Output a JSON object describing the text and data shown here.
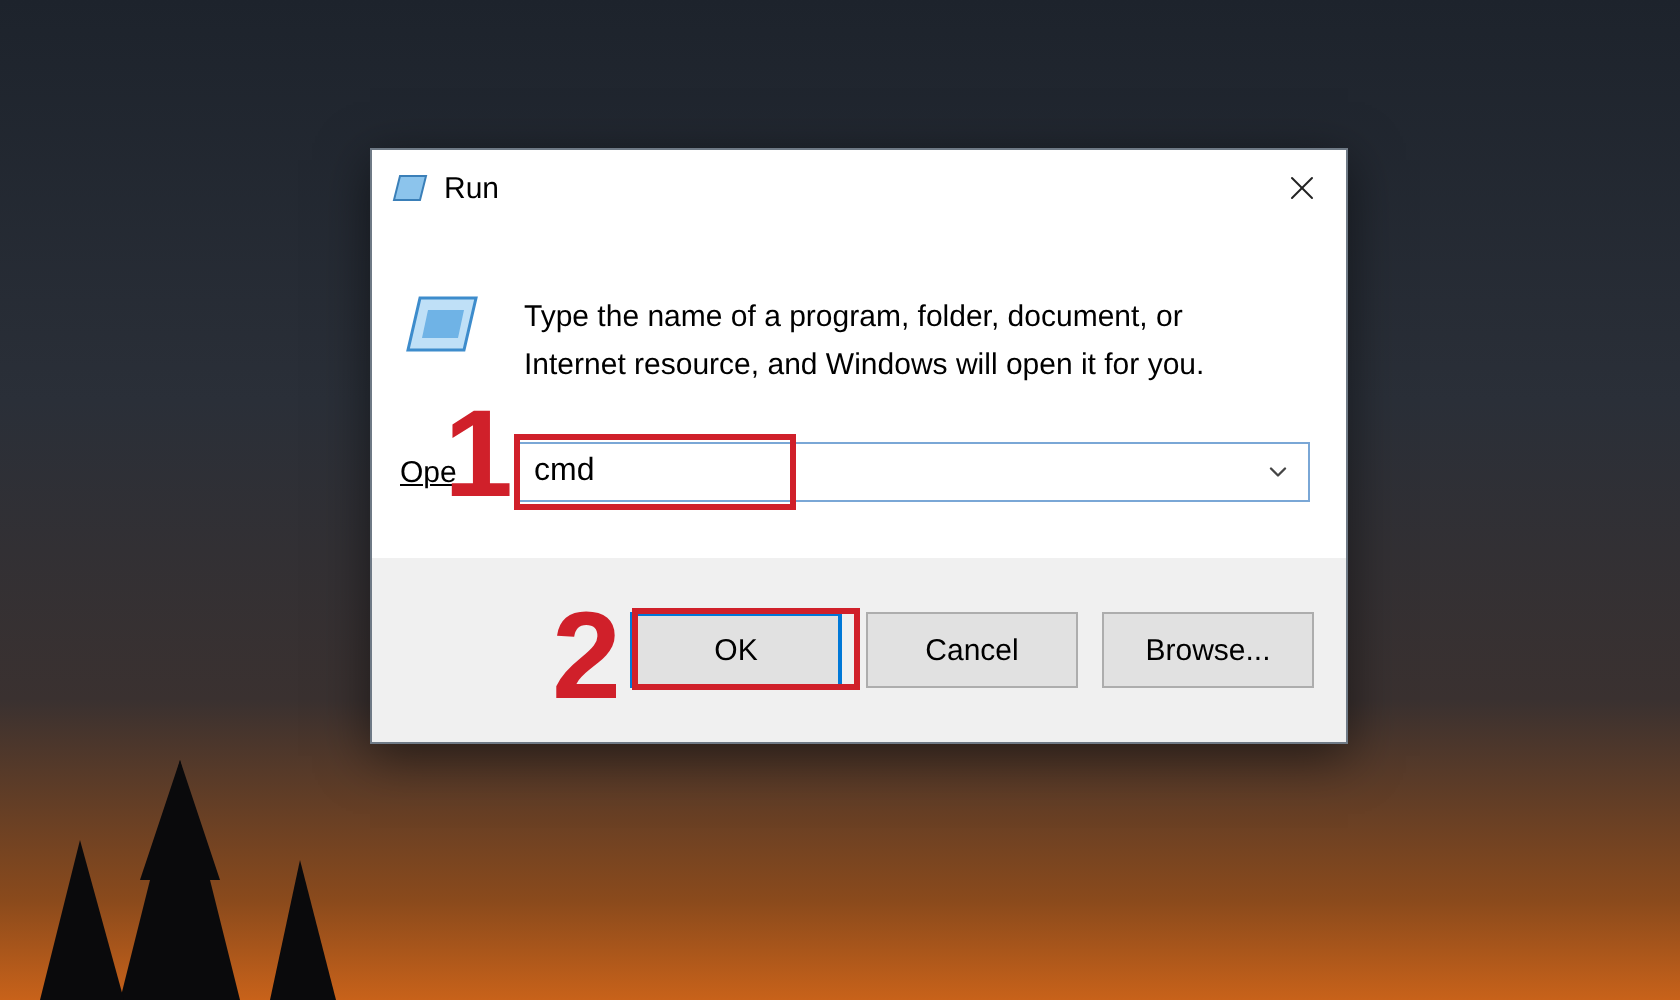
{
  "window": {
    "title": "Run",
    "message": "Type the name of a program, folder, document, or Internet resource, and Windows will open it for you."
  },
  "open_field": {
    "label": "Ope",
    "value": "cmd"
  },
  "buttons": [
    {
      "label": "OK",
      "focused": true
    },
    {
      "label": "Cancel",
      "focused": false
    },
    {
      "label": "Browse...",
      "focused": false
    }
  ],
  "annotations": [
    {
      "label": "1"
    },
    {
      "label": "2"
    }
  ]
}
